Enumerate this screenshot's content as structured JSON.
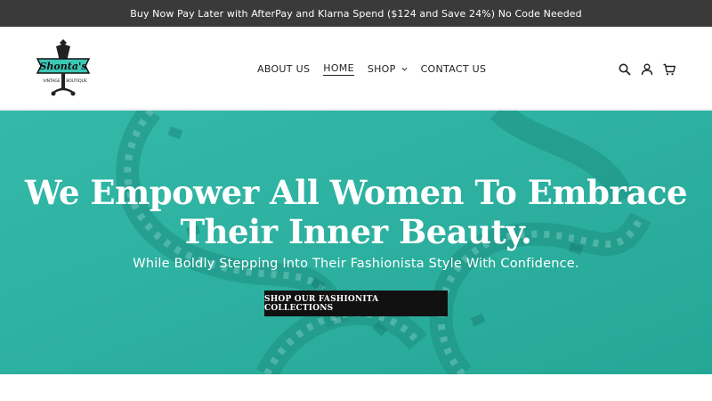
{
  "announcement": "Buy Now Pay Later with AfterPay and Klarna Spend ($124 and Save 24%) No Code Needed",
  "logo": {
    "brand": "Shonta's",
    "tagline": "VINTAGE BOUTIQUE",
    "teal": "#3cc7b6"
  },
  "nav": {
    "items": [
      {
        "label": "ABOUT US"
      },
      {
        "label": "HOME",
        "active": true
      },
      {
        "label": "SHOP",
        "dropdown": true
      },
      {
        "label": "CONTACT US"
      }
    ]
  },
  "header_icons": [
    "search-icon",
    "account-icon",
    "cart-icon"
  ],
  "hero": {
    "title_line1": "We Empower All Women To Embrace",
    "title_line2": "Their Inner Beauty.",
    "subtitle": "While Boldly Stepping Into Their Fashionista Style With Confidence.",
    "cta": "SHOP OUR FASHIONITA COLLECTIONS",
    "overlay_color": "#2fb2a2"
  }
}
